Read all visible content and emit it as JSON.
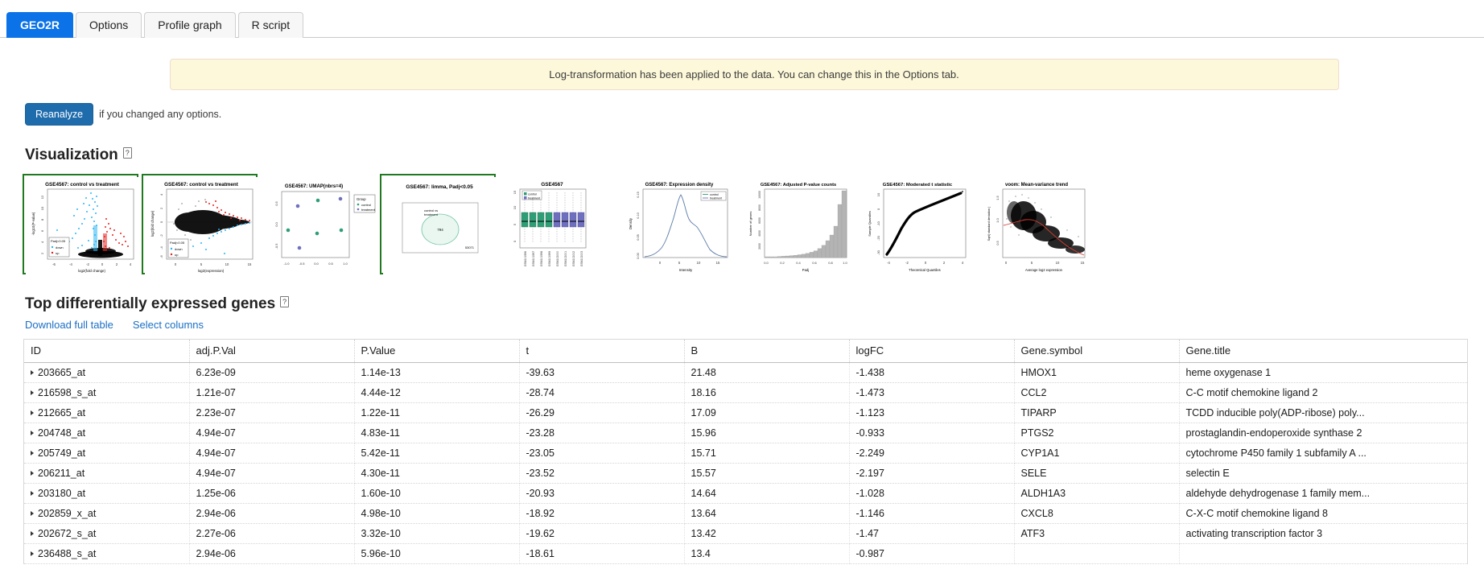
{
  "tabs": [
    {
      "label": "GEO2R",
      "active": true
    },
    {
      "label": "Options",
      "active": false
    },
    {
      "label": "Profile graph",
      "active": false
    },
    {
      "label": "R script",
      "active": false
    }
  ],
  "banner": {
    "message": "Log-transformation has been applied to the data. You can change this in the Options tab."
  },
  "reanalyze": {
    "button_label": "Reanalyze",
    "hint": "if you changed any options."
  },
  "visualization": {
    "heading": "Visualization",
    "help_glyph": "?",
    "thumbnails": [
      {
        "name": "volcano-plot",
        "title": "GSE4567: control vs treatment",
        "xlabel": "log2(fold change)",
        "ylabel": "-log10(P-value)",
        "legend_title": "Padj<0.05",
        "legend": [
          "down",
          "up"
        ],
        "selected": true
      },
      {
        "name": "md-plot",
        "title": "GSE4567: control vs treatment",
        "xlabel": "log2(expression)",
        "ylabel": "log2(fold change)",
        "legend_title": "Padj<0.05",
        "legend": [
          "down",
          "up"
        ],
        "selected": true
      },
      {
        "name": "umap-plot",
        "title": "GSE4567: UMAP(nbrs=4)",
        "legend_title": "Group",
        "legend": [
          "control",
          "treatment"
        ],
        "selected": false
      },
      {
        "name": "venn-diagram",
        "title": "GSE4567: limma, Padj<0.05",
        "set_label": "control vs treatment",
        "inside_count": "794",
        "outside_count": "53071",
        "selected": true
      },
      {
        "name": "boxplot",
        "title": "GSE4567",
        "legend": [
          "control",
          "treatment"
        ],
        "samples": [
          "GSM101996",
          "GSM101997",
          "GSM101998",
          "GSM101999",
          "GSM102000",
          "GSM102001",
          "GSM102002",
          "GSM102003"
        ],
        "selected": false
      },
      {
        "name": "expression-density-plot",
        "title": "GSE4567: Expression density",
        "xlabel": "Intensity",
        "ylabel": "Density",
        "legend": [
          "control",
          "treatment"
        ],
        "selected": false
      },
      {
        "name": "adjusted-pvalue-histogram",
        "title": "GSE4567: Adjusted P-value counts",
        "xlabel": "Padj",
        "ylabel": "Number of genes",
        "selected": false
      },
      {
        "name": "qq-plot",
        "title": "GSE4567: Moderated t statistic",
        "xlabel": "Theoretical Quantiles",
        "ylabel": "Sample Quantiles",
        "selected": false
      },
      {
        "name": "mean-variance-trend-plot",
        "title": "voom: Mean-variance trend",
        "xlabel": "Average log2 expression",
        "ylabel": "Sqrt( standard deviation )",
        "selected": false
      }
    ]
  },
  "results": {
    "heading": "Top differentially expressed genes",
    "help_glyph": "?",
    "download_link": "Download full table",
    "select_columns_link": "Select columns",
    "columns": [
      "ID",
      "adj.P.Val",
      "P.Value",
      "t",
      "B",
      "logFC",
      "Gene.symbol",
      "Gene.title"
    ],
    "rows": [
      {
        "id": "203665_at",
        "adjp": "6.23e-09",
        "pval": "1.14e-13",
        "t": "-39.63",
        "b": "21.48",
        "logfc": "-1.438",
        "symbol": "HMOX1",
        "title": "heme oxygenase 1"
      },
      {
        "id": "216598_s_at",
        "adjp": "1.21e-07",
        "pval": "4.44e-12",
        "t": "-28.74",
        "b": "18.16",
        "logfc": "-1.473",
        "symbol": "CCL2",
        "title": "C-C motif chemokine ligand 2"
      },
      {
        "id": "212665_at",
        "adjp": "2.23e-07",
        "pval": "1.22e-11",
        "t": "-26.29",
        "b": "17.09",
        "logfc": "-1.123",
        "symbol": "TIPARP",
        "title": "TCDD inducible poly(ADP-ribose) poly..."
      },
      {
        "id": "204748_at",
        "adjp": "4.94e-07",
        "pval": "4.83e-11",
        "t": "-23.28",
        "b": "15.96",
        "logfc": "-0.933",
        "symbol": "PTGS2",
        "title": "prostaglandin-endoperoxide synthase 2"
      },
      {
        "id": "205749_at",
        "adjp": "4.94e-07",
        "pval": "5.42e-11",
        "t": "-23.05",
        "b": "15.71",
        "logfc": "-2.249",
        "symbol": "CYP1A1",
        "title": "cytochrome P450 family 1 subfamily A ..."
      },
      {
        "id": "206211_at",
        "adjp": "4.94e-07",
        "pval": "4.30e-11",
        "t": "-23.52",
        "b": "15.57",
        "logfc": "-2.197",
        "symbol": "SELE",
        "title": "selectin E"
      },
      {
        "id": "203180_at",
        "adjp": "1.25e-06",
        "pval": "1.60e-10",
        "t": "-20.93",
        "b": "14.64",
        "logfc": "-1.028",
        "symbol": "ALDH1A3",
        "title": "aldehyde dehydrogenase 1 family mem..."
      },
      {
        "id": "202859_x_at",
        "adjp": "2.94e-06",
        "pval": "4.98e-10",
        "t": "-18.92",
        "b": "13.64",
        "logfc": "-1.146",
        "symbol": "CXCL8",
        "title": "C-X-C motif chemokine ligand 8"
      },
      {
        "id": "202672_s_at",
        "adjp": "2.27e-06",
        "pval": "3.32e-10",
        "t": "-19.62",
        "b": "13.42",
        "logfc": "-1.47",
        "symbol": "ATF3",
        "title": "activating transcription factor 3"
      },
      {
        "id": "236488_s_at",
        "adjp": "2.94e-06",
        "pval": "5.96e-10",
        "t": "-18.61",
        "b": "13.4",
        "logfc": "-0.987",
        "symbol": "",
        "title": ""
      }
    ]
  },
  "colors": {
    "accent_blue": "#0b72e7",
    "button_blue": "#1f6cad",
    "link_blue": "#1a6fc4",
    "banner_bg": "#fdf8d9",
    "selected_border": "#1f7a1f",
    "down_blue": "#29b6f6",
    "up_red": "#e8231f",
    "control_green": "#2e9e76",
    "treatment_purple": "#6f6fc0"
  },
  "chart_data": [
    {
      "type": "scatter",
      "name": "volcano-plot",
      "title": "GSE4567: control vs treatment",
      "xlabel": "log2(fold change)",
      "ylabel": "-log10(P-value)",
      "xlim": [
        -6,
        4
      ],
      "ylim": [
        0,
        13
      ],
      "xticks": [
        -6,
        -4,
        -2,
        0,
        2,
        4
      ],
      "yticks": [
        2,
        4,
        6,
        8,
        10,
        12
      ],
      "legend": {
        "title": "Padj<0.05",
        "entries": [
          "down",
          "up"
        ],
        "colors": [
          "#29b6f6",
          "#e8231f"
        ],
        "position": "bottom-left"
      },
      "grid": false
    },
    {
      "type": "scatter",
      "name": "md-plot",
      "title": "GSE4567: control vs treatment",
      "xlabel": "log2(expression)",
      "ylabel": "log2(fold change)",
      "xlim": [
        0,
        15
      ],
      "ylim": [
        -6,
        4
      ],
      "xticks": [
        0,
        5,
        10,
        15
      ],
      "yticks": [
        -6,
        -4,
        -2,
        0,
        2,
        4
      ],
      "legend": {
        "title": "Padj<0.05",
        "entries": [
          "down",
          "up"
        ],
        "colors": [
          "#29b6f6",
          "#e8231f"
        ],
        "position": "bottom-left"
      },
      "grid": false
    },
    {
      "type": "scatter",
      "name": "umap-plot",
      "title": "GSE4567: UMAP(nbrs=4)",
      "xlim": [
        -1.0,
        1.0
      ],
      "ylim": [
        -0.6,
        0.6
      ],
      "xticks": [
        -1.0,
        -0.5,
        0.0,
        0.5,
        1.0
      ],
      "yticks": [
        -0.5,
        0.0,
        0.5
      ],
      "legend": {
        "title": "Group",
        "entries": [
          "control",
          "treatment"
        ],
        "colors": [
          "#2e9e76",
          "#6f6fc0"
        ],
        "position": "right"
      },
      "series": [
        {
          "name": "control",
          "points": [
            [
              -0.72,
              -0.13
            ],
            [
              0.08,
              0.42
            ],
            [
              0.05,
              -0.18
            ],
            [
              0.62,
              -0.11
            ]
          ]
        },
        {
          "name": "treatment",
          "points": [
            [
              -0.35,
              0.3
            ],
            [
              -0.52,
              -0.4
            ],
            [
              0.6,
              0.43
            ],
            [
              0.55,
              0.42
            ]
          ]
        }
      ]
    },
    {
      "type": "pie",
      "name": "venn-diagram",
      "title": "GSE4567: limma, Padj<0.05",
      "set_label": "control vs treatment",
      "values": [
        794,
        53071
      ],
      "labels": [
        "in set",
        "outside"
      ]
    },
    {
      "type": "bar",
      "name": "boxplot",
      "title": "GSE4567",
      "categories": [
        "GSM101996",
        "GSM101997",
        "GSM101998",
        "GSM101999",
        "GSM102000",
        "GSM102001",
        "GSM102002",
        "GSM102003"
      ],
      "ylim": [
        -1,
        15
      ],
      "yticks": [
        0,
        5,
        10,
        15
      ],
      "boxes": [
        {
          "sample": "GSM101996",
          "group": "control",
          "low": -0.6,
          "q1": 5.0,
          "median": 6.6,
          "q3": 8.6,
          "high": 14.6
        },
        {
          "sample": "GSM101997",
          "group": "control",
          "low": -0.6,
          "q1": 5.0,
          "median": 6.6,
          "q3": 8.6,
          "high": 14.6
        },
        {
          "sample": "GSM101998",
          "group": "control",
          "low": -0.6,
          "q1": 5.0,
          "median": 6.6,
          "q3": 8.6,
          "high": 14.6
        },
        {
          "sample": "GSM101999",
          "group": "control",
          "low": -0.6,
          "q1": 5.0,
          "median": 6.6,
          "q3": 8.6,
          "high": 14.6
        },
        {
          "sample": "GSM102000",
          "group": "treatment",
          "low": -0.6,
          "q1": 5.0,
          "median": 6.6,
          "q3": 8.6,
          "high": 14.6
        },
        {
          "sample": "GSM102001",
          "group": "treatment",
          "low": -0.6,
          "q1": 5.0,
          "median": 6.6,
          "q3": 8.6,
          "high": 14.6
        },
        {
          "sample": "GSM102002",
          "group": "treatment",
          "low": -0.6,
          "q1": 5.0,
          "median": 6.6,
          "q3": 8.6,
          "high": 14.6
        },
        {
          "sample": "GSM102003",
          "group": "treatment",
          "low": -0.6,
          "q1": 5.0,
          "median": 6.6,
          "q3": 8.6,
          "high": 14.6
        }
      ],
      "legend": {
        "entries": [
          "control",
          "treatment"
        ],
        "colors": [
          "#2e9e76",
          "#6f6fc0"
        ],
        "position": "top-left"
      }
    },
    {
      "type": "line",
      "name": "expression-density-plot",
      "title": "GSE4567: Expression density",
      "xlabel": "Intensity",
      "ylabel": "Density",
      "xlim": [
        -2,
        17
      ],
      "ylim": [
        0,
        0.17
      ],
      "xticks": [
        0,
        5,
        10,
        15
      ],
      "yticks": [
        0.0,
        0.05,
        0.1,
        0.15
      ],
      "legend": {
        "entries": [
          "control",
          "treatment"
        ],
        "colors": [
          "#2e9e76",
          "#6f6fc0"
        ],
        "position": "top-right"
      }
    },
    {
      "type": "bar",
      "name": "adjusted-pvalue-histogram",
      "title": "GSE4567: Adjusted P-value counts",
      "xlabel": "Padj",
      "ylabel": "Number of genes",
      "xlim": [
        0,
        1
      ],
      "ylim": [
        0,
        11000
      ],
      "xticks": [
        0.0,
        0.2,
        0.4,
        0.6,
        0.8,
        1.0
      ],
      "yticks": [
        0,
        2000,
        4000,
        6000,
        8000,
        10000
      ],
      "categories": [
        "0.05",
        "0.10",
        "0.15",
        "0.20",
        "0.25",
        "0.30",
        "0.35",
        "0.40",
        "0.45",
        "0.50",
        "0.55",
        "0.60",
        "0.65",
        "0.70",
        "0.75",
        "0.80",
        "0.85",
        "0.90",
        "0.95",
        "1.00"
      ],
      "values": [
        120,
        140,
        160,
        190,
        220,
        260,
        300,
        360,
        430,
        520,
        650,
        820,
        1050,
        1400,
        1900,
        2600,
        3500,
        4900,
        8300,
        10800
      ]
    },
    {
      "type": "scatter",
      "name": "qq-plot",
      "title": "GSE4567: Moderated t statistic",
      "xlabel": "Theoretical Quantiles",
      "ylabel": "Sample Quantiles",
      "xlim": [
        -4,
        4
      ],
      "ylim": [
        -40,
        12
      ],
      "xticks": [
        -4,
        -2,
        0,
        2,
        4
      ],
      "yticks": [
        -30,
        -20,
        -10,
        0,
        10
      ]
    },
    {
      "type": "scatter",
      "name": "mean-variance-trend-plot",
      "title": "voom: Mean-variance trend",
      "xlabel": "Average log2 expression",
      "ylabel": "Sqrt( standard deviation )",
      "xlim": [
        0,
        15
      ],
      "ylim": [
        0.0,
        1.8
      ],
      "xticks": [
        0,
        5,
        10,
        15
      ],
      "yticks": [
        0.5,
        1.0,
        1.5
      ]
    }
  ]
}
